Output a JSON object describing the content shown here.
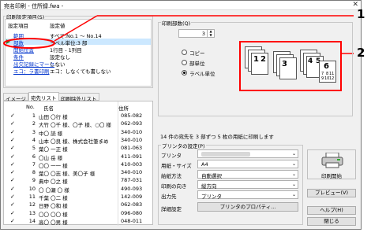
{
  "window": {
    "title": "宛名印刷 - 住所録.fwa -",
    "close": "✕"
  },
  "settings": {
    "group_label": "印刷設定項目(S)",
    "col_item": "設定項目",
    "col_value": "設定値",
    "rows": [
      {
        "item": "範囲",
        "value": "すべて:No.1 ～ No.14"
      },
      {
        "item": "部数",
        "value": "ラベル単位:3 部"
      },
      {
        "item": "開始位置",
        "value": "1行目 - 1列目"
      },
      {
        "item": "条件",
        "value": "設定なし"
      },
      {
        "item": "出欠記録にマーク",
        "value": "しない"
      },
      {
        "item": "エコ：ラ書印刷",
        "value": "エコ：しなくても書しない"
      }
    ]
  },
  "tabs": [
    "イメージ",
    "宛先リスト",
    "印刷除外リスト"
  ],
  "address_list": {
    "col_no": "No.",
    "col_name": "氏名",
    "col_addr": "住所",
    "rows": [
      {
        "no": "1",
        "name": "山田 〇行 様",
        "addr": "085-082"
      },
      {
        "no": "2",
        "name": "大竹 〇千 様、〇子 様、○〇 様",
        "addr": "062-093"
      },
      {
        "no": "3",
        "name": "中〇 読 様",
        "addr": "340-010"
      },
      {
        "no": "4",
        "name": "山本 〇良 様、株式会社筆まめ",
        "addr": "340-010"
      },
      {
        "no": "5",
        "name": "葉〇 一正 様",
        "addr": "081-063"
      },
      {
        "no": "6",
        "name": "〇山 岳 様",
        "addr": "411-091"
      },
      {
        "no": "7",
        "name": "〇〇 一一 様",
        "addr": "410-003"
      },
      {
        "no": "8",
        "name": "葉〇 〇志 様、美〇子 様",
        "addr": "340-010"
      },
      {
        "no": "9",
        "name": "典中 〇之 様",
        "addr": "787-031"
      },
      {
        "no": "10",
        "name": "〇 〇瀬 〇 様",
        "addr": "490-093"
      },
      {
        "no": "11",
        "name": "千葉 〇二 様",
        "addr": "142-009"
      },
      {
        "no": "12",
        "name": "日野 〇和 様",
        "addr": "062-083"
      },
      {
        "no": "13",
        "name": "〇〇 〇〇 様",
        "addr": "096-080"
      },
      {
        "no": "14",
        "name": "高〇 〇男 様",
        "addr": "048-011"
      }
    ]
  },
  "copies": {
    "group_label": "印刷部数(Q)",
    "value": "3",
    "options": [
      "コピー",
      "部単位",
      "ラベル単位"
    ],
    "selected_index": 2,
    "preview_numbers": [
      "1",
      "2",
      "3",
      "4",
      "5",
      "6",
      "7",
      "8",
      "9",
      "10",
      "11",
      "12"
    ]
  },
  "summary": "14 件の宛先を 3 部ずつ 5 枚の用紙に印刷します",
  "printer": {
    "group_label": "プリンタの設定(P)",
    "rows": [
      {
        "label": "プリンタ",
        "value": ""
      },
      {
        "label": "用紙・サイズ",
        "value": "A4"
      },
      {
        "label": "給紙方法",
        "value": "自動選択"
      },
      {
        "label": "印刷の向き",
        "value": "縦方向"
      },
      {
        "label": "出力先",
        "value": "プリンタ"
      }
    ],
    "detail_label": "詳細設定",
    "properties_button": "プリンタのプロパティ..."
  },
  "buttons": {
    "print": "印刷開始",
    "preview": "プレビュー(V)",
    "help": "ヘルプ(H)",
    "close": "閉じる"
  },
  "callouts": [
    "1",
    "2"
  ],
  "colors": {
    "highlight": "#ff0000",
    "link": "#0033cc",
    "selected_row": "#cce8ff"
  }
}
